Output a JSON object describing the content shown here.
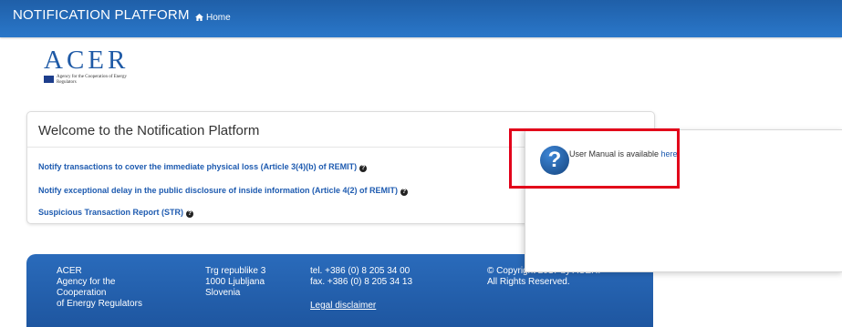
{
  "topbar": {
    "brand": "NOTIFICATION PLATFORM",
    "home_label": "Home",
    "home_icon": "home-icon"
  },
  "logo": {
    "letters": "ACER",
    "subtitle": "Agency for the Cooperation of Energy Regulators"
  },
  "welcome": {
    "title": "Welcome to the Notification Platform",
    "links": [
      "Notify transactions to cover the immediate physical loss (Article 3(4)(b) of REMIT)",
      "Notify exceptional delay in the public disclosure of inside information (Article 4(2) of REMIT)",
      "Suspicious Transaction Report (STR)"
    ],
    "help_icon": "question-circle-icon"
  },
  "footer": {
    "org": [
      "ACER",
      "Agency for the",
      "Cooperation",
      "of Energy Regulators"
    ],
    "address": [
      "Trg republike 3",
      "1000 Ljubljana",
      "Slovenia"
    ],
    "phone": "tel. +386 (0) 8 205 34 00",
    "fax": "fax. +386 (0) 8 205 34 13",
    "legal_link": "Legal disclaimer",
    "copyright": "© Copyright 2017 by ACER.",
    "rights": "All Rights Reserved."
  },
  "popup": {
    "text": "User Manual is available ",
    "link": "here",
    "suffix": ".",
    "icon": "question-icon",
    "highlight_color": "#e2001a"
  }
}
